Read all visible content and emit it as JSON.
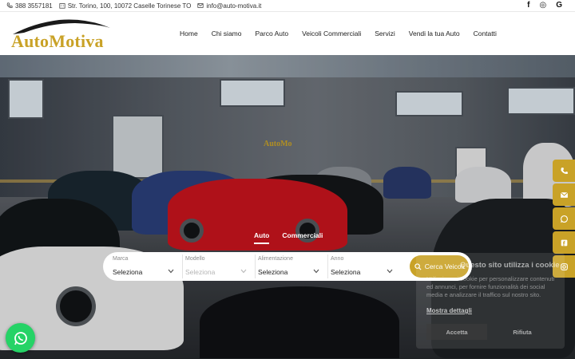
{
  "topbar": {
    "phone": "388 3557181",
    "address": "Str. Torino, 100, 10072 Caselle Torinese TO",
    "email": "info@auto-motiva.it",
    "social": [
      "f",
      "◎",
      "G"
    ]
  },
  "logo": {
    "text": "AutoMotiva"
  },
  "nav": {
    "items": [
      "Home",
      "Chi siamo",
      "Parco Auto",
      "Veicoli Commerciali",
      "Servizi",
      "Vendi la tua Auto",
      "Contatti"
    ]
  },
  "hero": {
    "showroom_sign": "AutoMo",
    "tabs": [
      "Auto",
      "Commerciali"
    ],
    "active_tab": "Auto"
  },
  "search": {
    "fields": [
      {
        "label": "Marca",
        "value": "Seleziona"
      },
      {
        "label": "Modello",
        "value": "Seleziona"
      },
      {
        "label": "Alimentazione",
        "value": "Seleziona"
      },
      {
        "label": "Anno",
        "value": "Seleziona"
      }
    ],
    "button_label": "Cerca Veicoli"
  },
  "cookie": {
    "title": "Questo sito utilizza i cookie",
    "text": "Utilizziamo i cookie per personalizzare contenuti ed annunci, per fornire funzionalità dei social media e analizzare il traffico sul nostro sito.",
    "more": "Mostra dettagli",
    "accept": "Accetta",
    "reject": "Rifiuta"
  },
  "colors": {
    "accent": "#c9a227",
    "whatsapp": "#25d366"
  },
  "side_icons": [
    "phone-icon",
    "mail-icon",
    "whatsapp-icon",
    "facebook-icon",
    "instagram-icon"
  ]
}
